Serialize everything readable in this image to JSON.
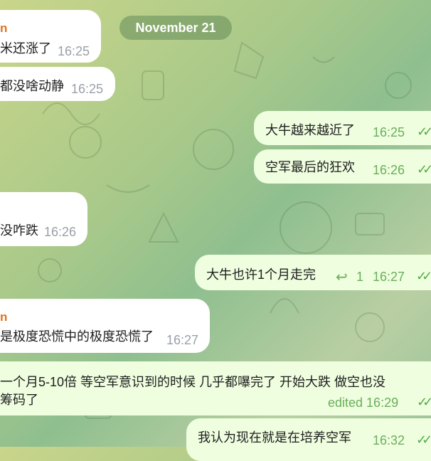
{
  "date_label": "November 21",
  "messages": [
    {
      "sender": "n",
      "text": "米还涨了",
      "time": "16:25"
    },
    {
      "text": "都没啥动静",
      "time": "16:25"
    },
    {
      "text": "大牛越来越近了",
      "time": "16:25",
      "status": "read"
    },
    {
      "text": "空军最后的狂欢",
      "time": "16:26",
      "status": "read"
    },
    {
      "text": "没咋跌",
      "time": "16:26"
    },
    {
      "text": "大牛也许1个月走完",
      "time": "16:27",
      "status": "read",
      "replies": "1"
    },
    {
      "sender": "n",
      "text": "是极度恐慌中的极度恐慌了",
      "time": "16:27"
    },
    {
      "text_line1": "一个月5-10倍   等空军意识到的时候  几乎都嚗完了   开始大跌  做空也没",
      "text_line2": "筹码了",
      "time": "edited 16:29",
      "status": "read"
    },
    {
      "text": "我认为现在就是在培养空军",
      "time": "16:32",
      "status": "read"
    }
  ],
  "icons": {
    "reply": "reply-arrow-icon",
    "read": "double-check-icon"
  }
}
